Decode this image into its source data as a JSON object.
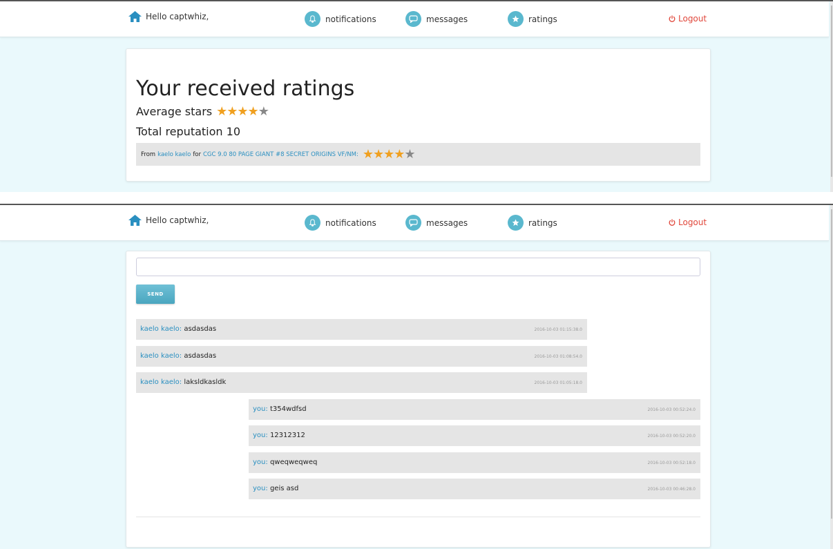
{
  "nav": {
    "greeting": "Hello captwhiz,",
    "notifications": "notifications",
    "messages": "messages",
    "ratings": "ratings",
    "logout": "Logout",
    "logout_color": "#e0463a",
    "accent": "#5ab8ce"
  },
  "ratings_page": {
    "title": "Your received ratings",
    "average_label": "Average stars",
    "average_stars": 4,
    "max_stars": 5,
    "reputation_label": "Total reputation 10",
    "entries": [
      {
        "from_label": "From",
        "from_user": "kaelo kaelo",
        "for_label": "for",
        "item": "CGC 9.0 80 PAGE GIANT #8 SECRET ORIGINS VF/NM:",
        "stars": 4
      }
    ]
  },
  "messages_page": {
    "input_value": "",
    "send_label": "SEND",
    "messages": [
      {
        "sender": "kaelo kaelo:",
        "text": "asdasdas",
        "timestamp": "2016-10-03 01:15:38.0",
        "side": "left"
      },
      {
        "sender": "kaelo kaelo:",
        "text": "asdasdas",
        "timestamp": "2016-10-03 01:08:54.0",
        "side": "left"
      },
      {
        "sender": "kaelo kaelo:",
        "text": "laksldkasldk",
        "timestamp": "2016-10-03 01:05:18.0",
        "side": "left"
      },
      {
        "sender": "you:",
        "text": "t354wdfsd",
        "timestamp": "2016-10-03 00:52:24.0",
        "side": "right"
      },
      {
        "sender": "you:",
        "text": "12312312",
        "timestamp": "2016-10-03 00:52:20.0",
        "side": "right"
      },
      {
        "sender": "you:",
        "text": "qweqweqweq",
        "timestamp": "2016-10-03 00:52:18.0",
        "side": "right"
      },
      {
        "sender": "you:",
        "text": "geis asd",
        "timestamp": "2016-10-03 00:46:28.0",
        "side": "right"
      }
    ]
  }
}
